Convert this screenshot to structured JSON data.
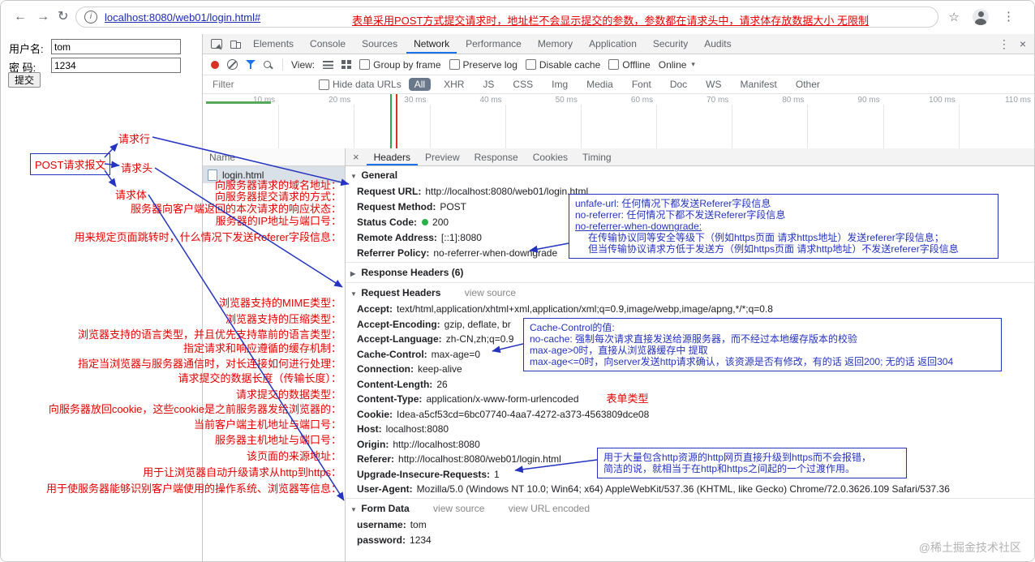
{
  "icons": {
    "back": "←",
    "forward": "→",
    "refresh": "↻",
    "info": "i",
    "star": "☆",
    "more": "⋮",
    "close": "×",
    "dropdown": "▾",
    "expanded": "▼",
    "collapsed": "▶"
  },
  "browser": {
    "url": "localhost:8080/web01/login.html#",
    "annotation": "表单采用POST方式提交请求时，地址栏不会显示提交的参数，参数都在请求头中，请求体存放数据大小 无限制"
  },
  "page": {
    "username_label": "用户名:",
    "username_value": "tom",
    "password_label": "密 码:",
    "password_value": "1234",
    "submit_label": "提交"
  },
  "diagram": {
    "post_packet": "POST请求报文",
    "request_line": "请求行",
    "request_head": "请求头",
    "request_body": "请求体",
    "content_type_note": "表单类型",
    "items": [
      "向服务器请求的域名地址：",
      "向服务器提交请求的方式：",
      "服务器向客户端返回的本次请求的响应状态：",
      "服务器的IP地址与端口号：",
      "用来规定页面跳转时，什么情况下发送Referer字段信息：",
      "浏览器支持的MIME类型：",
      "浏览器支持的压缩类型：",
      "浏览器支持的语言类型，并且优先支持靠前的语言类型：",
      "指定请求和响应遵循的缓存机制：",
      "指定当浏览器与服务器通信时，对长连接如何进行处理：",
      "请求提交的数据长度（传输长度）：",
      "请求提交的数据类型：",
      "向服务器放回cookie，这些cookie是之前服务器发给浏览器的：",
      "当前客户端主机地址与端口号：",
      "服务器主机地址与端口号：",
      "该页面的来源地址：",
      "用于让浏览器自动升级请求从http到https：",
      "用于使服务器能够识别客户端使用的操作系统、浏览器等信息："
    ]
  },
  "devtools": {
    "tabs": [
      "Elements",
      "Console",
      "Sources",
      "Network",
      "Performance",
      "Memory",
      "Application",
      "Security",
      "Audits"
    ],
    "toolbar": {
      "view_label": "View:",
      "group_by_frame": "Group by frame",
      "preserve_log": "Preserve log",
      "disable_cache": "Disable cache",
      "offline": "Offline",
      "throttling": "Online"
    },
    "filter": {
      "placeholder": "Filter",
      "hide_data_urls": "Hide data URLs",
      "chips": [
        "All",
        "XHR",
        "JS",
        "CSS",
        "Img",
        "Media",
        "Font",
        "Doc",
        "WS",
        "Manifest",
        "Other"
      ]
    },
    "timeline": {
      "ticks": [
        "10 ms",
        "20 ms",
        "30 ms",
        "40 ms",
        "50 ms",
        "60 ms",
        "70 ms",
        "80 ms",
        "90 ms",
        "100 ms",
        "110 ms"
      ]
    },
    "request_list": {
      "header": "Name",
      "file": "login.html"
    },
    "details": {
      "tabs": [
        "Headers",
        "Preview",
        "Response",
        "Cookies",
        "Timing"
      ],
      "general": {
        "title": "General",
        "items": [
          {
            "n": "Request URL:",
            "v": "http://localhost:8080/web01/login.html"
          },
          {
            "n": "Request Method:",
            "v": "POST"
          },
          {
            "n": "Status Code:",
            "v": "200"
          },
          {
            "n": "Remote Address:",
            "v": "[::1]:8080"
          },
          {
            "n": "Referrer Policy:",
            "v": "no-referrer-when-downgrade"
          }
        ]
      },
      "response_headers_title": "Response Headers (6)",
      "request_headers": {
        "title": "Request Headers",
        "view_source": "view source",
        "items": [
          {
            "n": "Accept:",
            "v": "text/html,application/xhtml+xml,application/xml;q=0.9,image/webp,image/apng,*/*;q=0.8"
          },
          {
            "n": "Accept-Encoding:",
            "v": "gzip, deflate, br"
          },
          {
            "n": "Accept-Language:",
            "v": "zh-CN,zh;q=0.9"
          },
          {
            "n": "Cache-Control:",
            "v": "max-age=0"
          },
          {
            "n": "Connection:",
            "v": "keep-alive"
          },
          {
            "n": "Content-Length:",
            "v": "26"
          },
          {
            "n": "Content-Type:",
            "v": "application/x-www-form-urlencoded"
          },
          {
            "n": "Cookie:",
            "v": "Idea-a5cf53cd=6bc07740-4aa7-4272-a373-4563809dce08"
          },
          {
            "n": "Host:",
            "v": "localhost:8080"
          },
          {
            "n": "Origin:",
            "v": "http://localhost:8080"
          },
          {
            "n": "Referer:",
            "v": "http://localhost:8080/web01/login.html"
          },
          {
            "n": "Upgrade-Insecure-Requests:",
            "v": "1"
          },
          {
            "n": "User-Agent:",
            "v": "Mozilla/5.0 (Windows NT 10.0; Win64; x64) AppleWebKit/537.36 (KHTML, like Gecko) Chrome/72.0.3626.109 Safari/537.36"
          }
        ]
      },
      "form_data": {
        "title": "Form Data",
        "view_source": "view source",
        "view_url_encoded": "view URL encoded",
        "items": [
          {
            "n": "username:",
            "v": "tom"
          },
          {
            "n": "password:",
            "v": "1234"
          }
        ]
      }
    }
  },
  "callouts": {
    "referrer_policy": {
      "lines": [
        "unfafe-url: 任何情况下都发送Referer字段信息",
        "no-referrer: 任何情况下都不发送Referer字段信息",
        "no-referrer-when-downgrade:",
        "在传输协议同等安全等级下（例如https页面 请求https地址）发送referer字段信息；",
        "但当传输协议请求方低于发送方（例如https页面 请求http地址）不发送referer字段信息"
      ]
    },
    "cache_control": {
      "lines": [
        "Cache-Control的值:",
        "no-cache: 强制每次请求直接发送给源服务器，而不经过本地缓存版本的校验",
        "max-age>0时，直接从浏览器缓存中 提取",
        "max-age<=0时，向server发送http请求确认，该资源是否有修改，有的话 返回200; 无的话 返回304"
      ]
    },
    "upgrade": {
      "lines": [
        "用于大量包含http资源的http网页直接升级到https而不会报错，",
        "简洁的说，就相当于在http和https之间起的一个过渡作用。"
      ]
    }
  },
  "watermark": "@稀土掘金技术社区"
}
